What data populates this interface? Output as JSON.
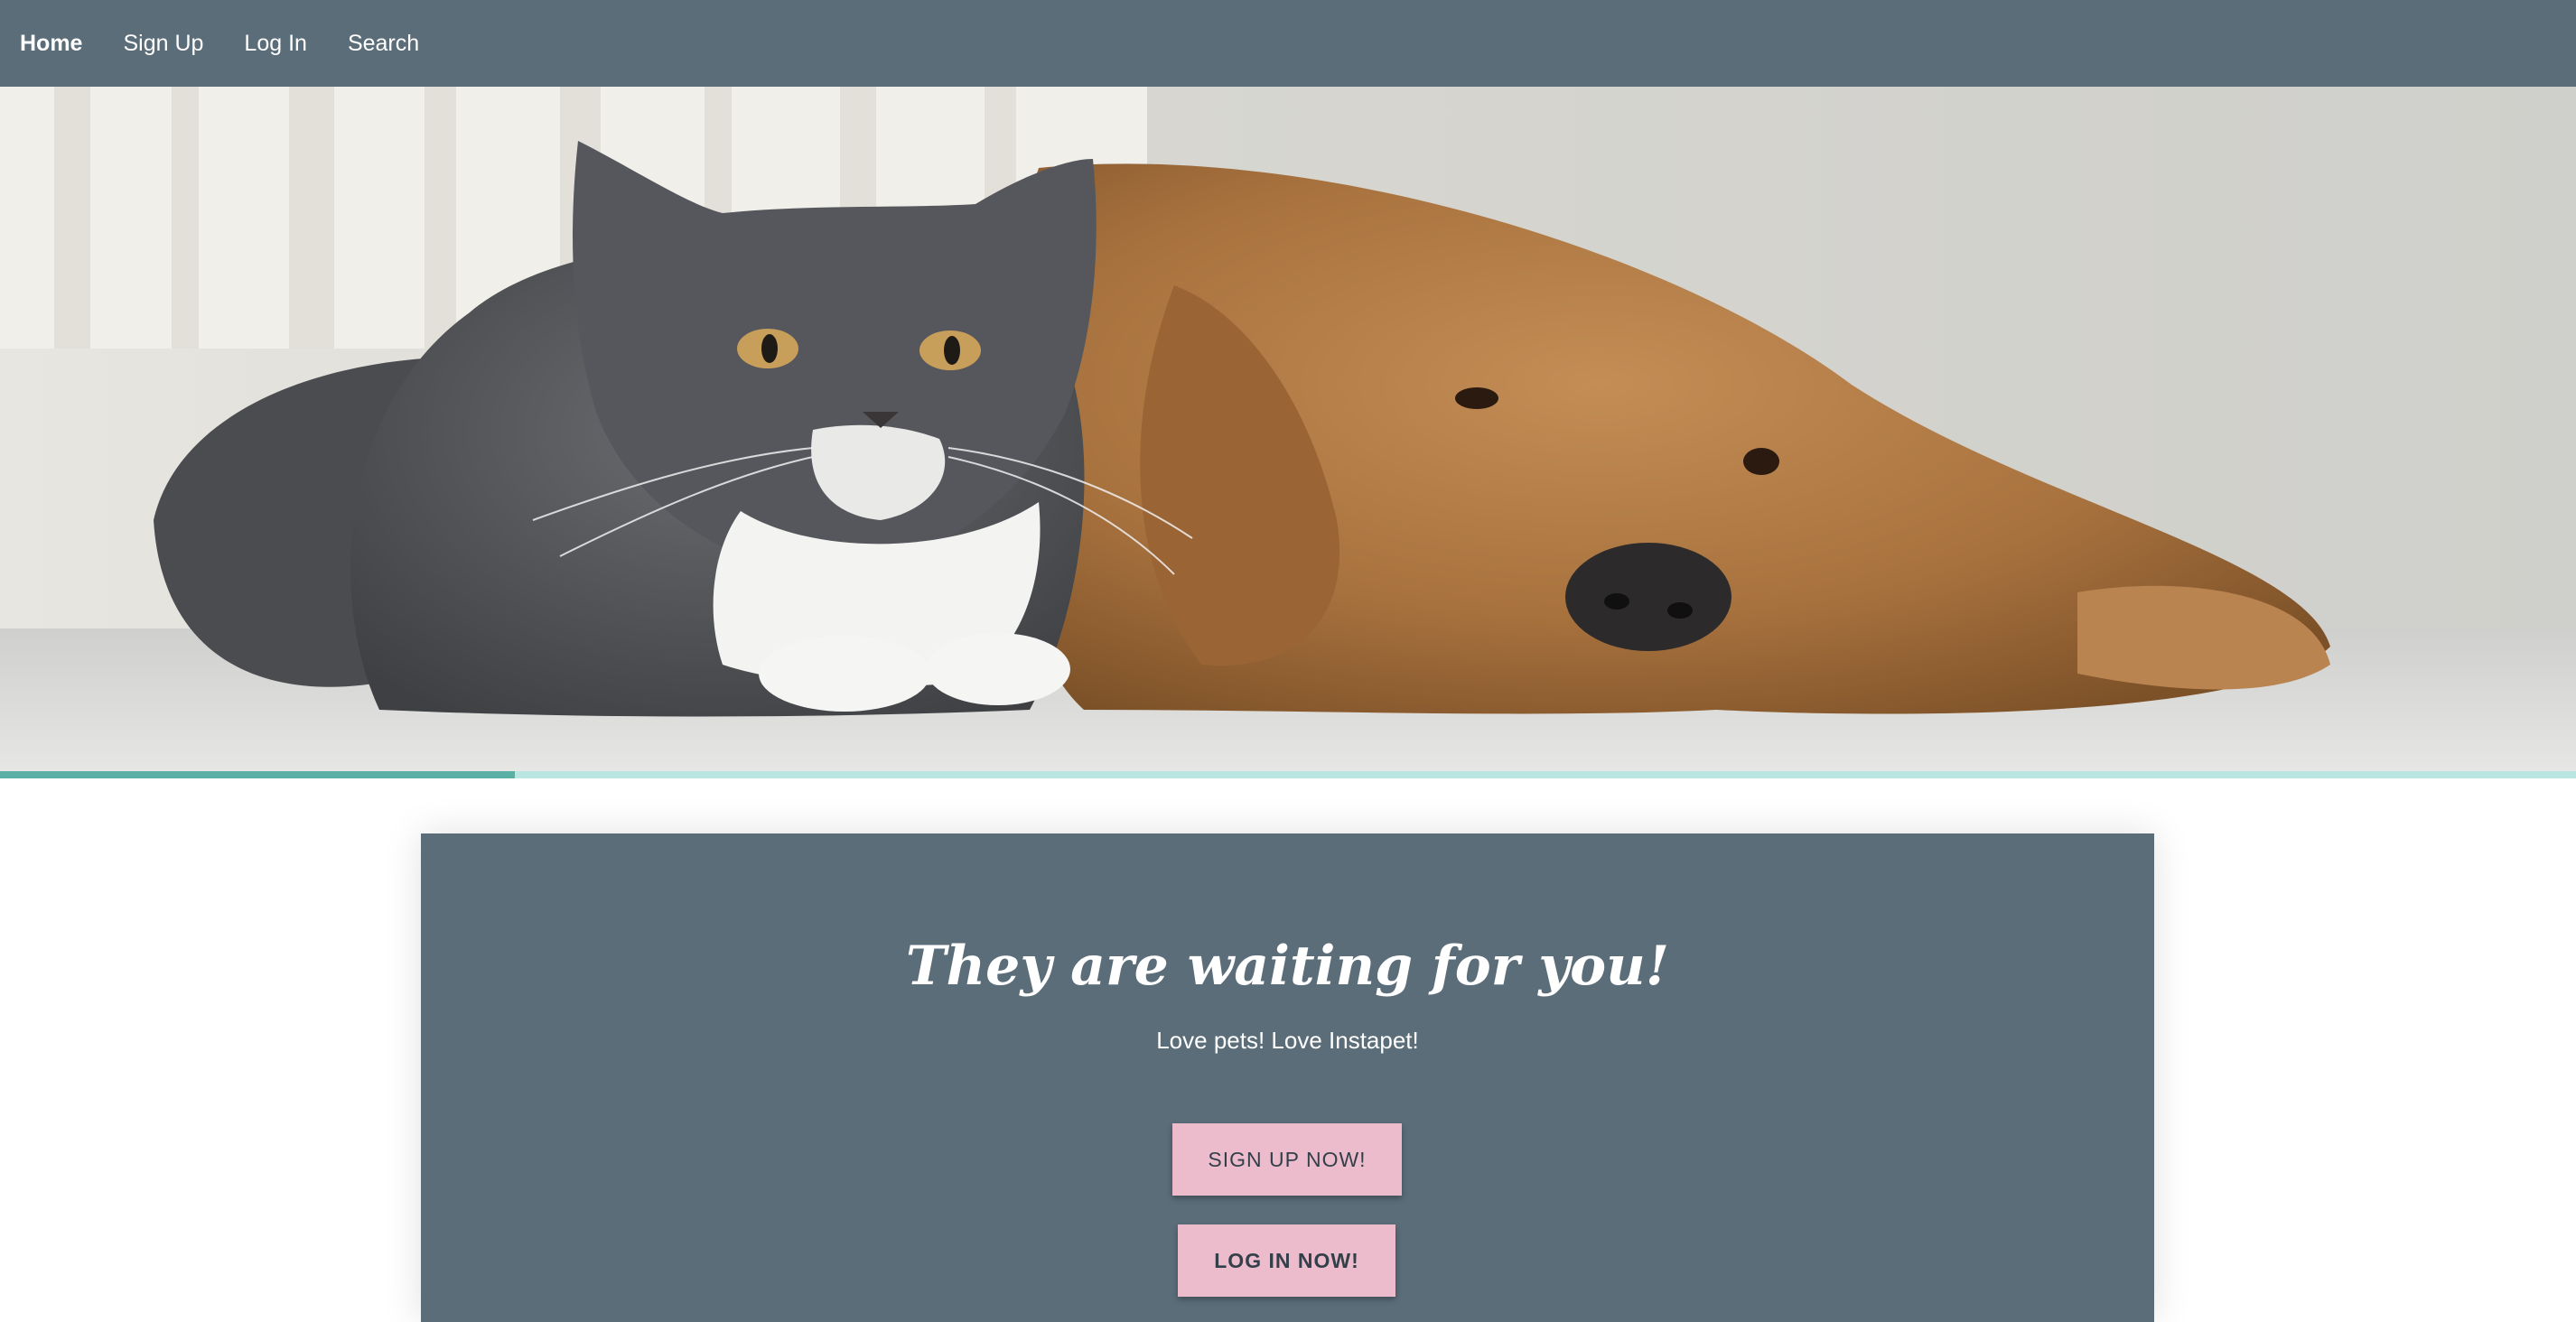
{
  "nav": {
    "items": [
      {
        "label": "Home",
        "active": true
      },
      {
        "label": "Sign Up",
        "active": false
      },
      {
        "label": "Log In",
        "active": false
      },
      {
        "label": "Search",
        "active": false
      }
    ],
    "background": "#5a6d79"
  },
  "hero": {
    "image": "cat-and-dog-photo"
  },
  "progress": {
    "value": 0.2,
    "fill_color": "#5ab0a4",
    "track_color": "#b9e6e1"
  },
  "cta": {
    "title": "They are waiting for you!",
    "subtitle": "Love pets! Love Instapet!",
    "signup_label": "SIGN UP NOW!",
    "login_label": "LOG IN NOW!",
    "button_color": "#ecbccd",
    "background": "#5a6d79"
  }
}
